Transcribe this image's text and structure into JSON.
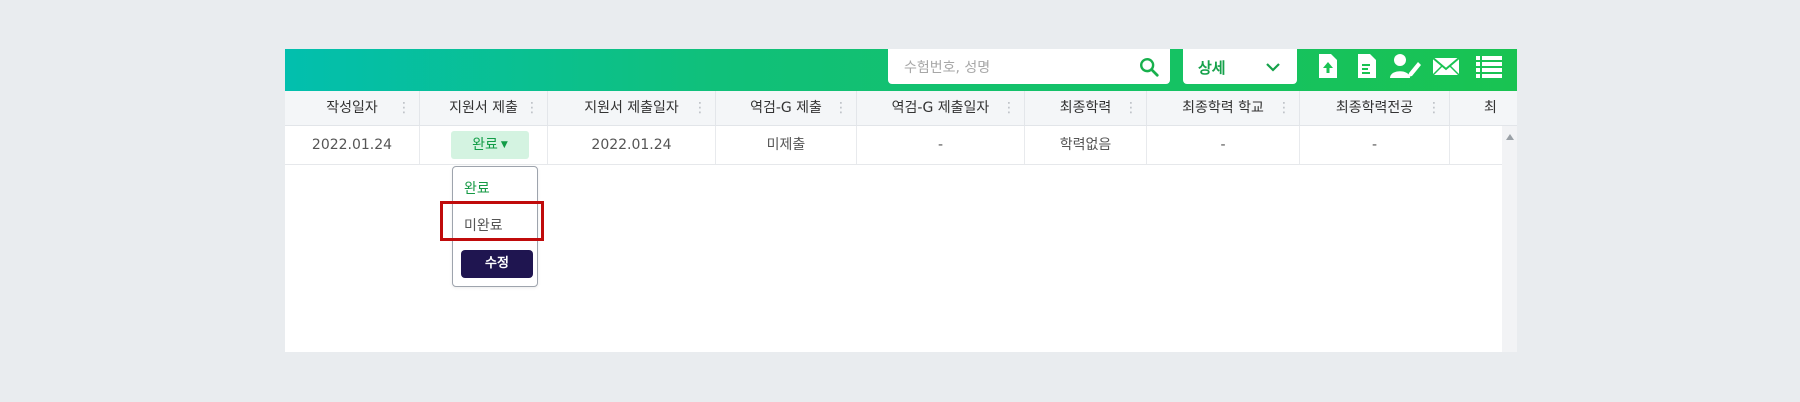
{
  "search": {
    "placeholder": "수험번호, 성명"
  },
  "detail": {
    "label": "상세"
  },
  "toolbar_icons": [
    "file-upload-icon",
    "file-text-icon",
    "user-edit-icon",
    "mail-icon",
    "list-icon"
  ],
  "columns": [
    "작성일자",
    "지원서 제출",
    "지원서 제출일자",
    "역검-G 제출",
    "역검-G 제출일자",
    "최종학력",
    "최종학력 학교",
    "최종학력전공",
    "최"
  ],
  "row": {
    "created_date": "2022.01.24",
    "application_status": "완료",
    "application_date": "2022.01.24",
    "test_status": "미제출",
    "test_date": "-",
    "education": "학력없음",
    "school": "-",
    "major": "-"
  },
  "dropdown": {
    "options": [
      "완료",
      "미완료"
    ],
    "submit_label": "수정"
  },
  "colors": {
    "accent_green": "#19c352",
    "gradient_start": "#02bfae",
    "submit_button": "#1f1550",
    "highlight": "#c00b0b"
  }
}
